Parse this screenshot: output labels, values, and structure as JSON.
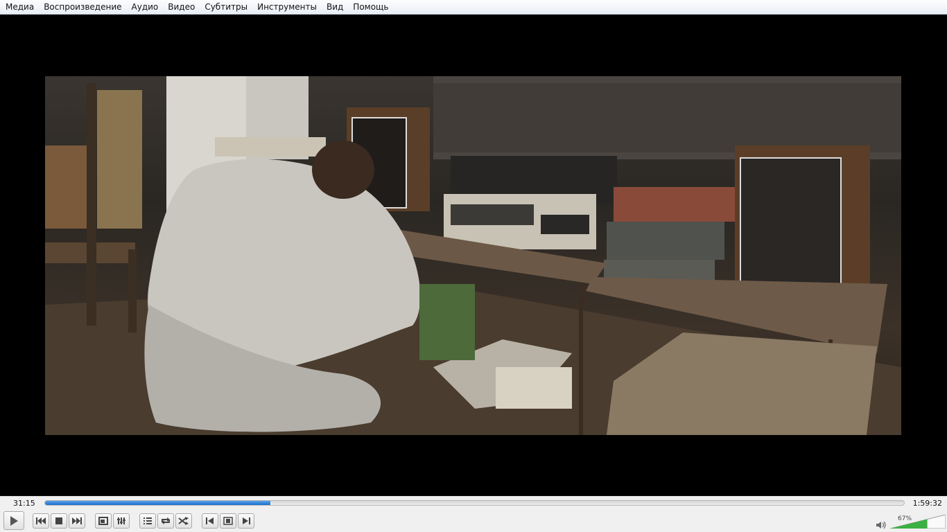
{
  "menu": [
    "Медиа",
    "Воспроизведение",
    "Аудио",
    "Видео",
    "Субтитры",
    "Инструменты",
    "Вид",
    "Помощь"
  ],
  "playback": {
    "elapsed": "31:15",
    "total": "1:59:32",
    "progress": 0.262
  },
  "volume": {
    "label": "67%",
    "level": 0.67
  },
  "icons": {
    "play": "play-icon",
    "previous": "previous-icon",
    "stop": "stop-icon",
    "next": "next-icon",
    "fullscreen": "fullscreen-icon",
    "extended_settings": "equalizer-icon",
    "playlist": "playlist-icon",
    "loop": "loop-icon",
    "random": "shuffle-icon",
    "frame_back": "frame-back-icon",
    "snapshot": "snapshot-icon",
    "frame_forward": "frame-forward-icon",
    "mute": "speaker-icon"
  },
  "colors": {
    "progress": "#1b6fcf",
    "volume": "#3cb043"
  }
}
